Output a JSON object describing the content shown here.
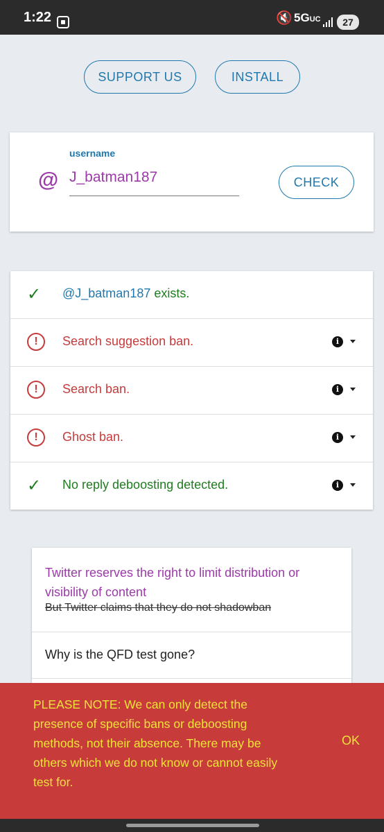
{
  "status_bar": {
    "time": "1:22",
    "network": "5G",
    "network_sub": "UC",
    "battery": "27"
  },
  "actions": {
    "support_label": "SUPPORT US",
    "install_label": "INSTALL"
  },
  "search": {
    "at_symbol": "@",
    "label": "username",
    "value": "J_batman187",
    "check_label": "CHECK"
  },
  "results": {
    "exists_handle": "@J_batman187",
    "exists_suffix": " exists.",
    "items": [
      {
        "label": "Search suggestion ban.",
        "status": "ban"
      },
      {
        "label": "Search ban.",
        "status": "ban"
      },
      {
        "label": "Ghost ban.",
        "status": "ban"
      },
      {
        "label": "No reply deboosting detected.",
        "status": "ok"
      }
    ]
  },
  "faq": {
    "item1_title": "Twitter reserves the right to limit distribution or visibility of content",
    "item1_sub": "But Twitter claims that they do not shadowban",
    "item2_title": "Why is the QFD test gone?"
  },
  "notice": {
    "message": "PLEASE NOTE: We can only detect the presence of specific bans or deboosting methods, not their absence. There may be others which we do not know or cannot easily test for.",
    "ok_label": "OK"
  },
  "colors": {
    "accent_blue": "#1f78ad",
    "accent_purple": "#9b3aa8",
    "error_red": "#c63b3b",
    "success_green": "#1e7d1e",
    "banner_bg": "#c83b3b",
    "banner_text": "#f1e23a"
  }
}
